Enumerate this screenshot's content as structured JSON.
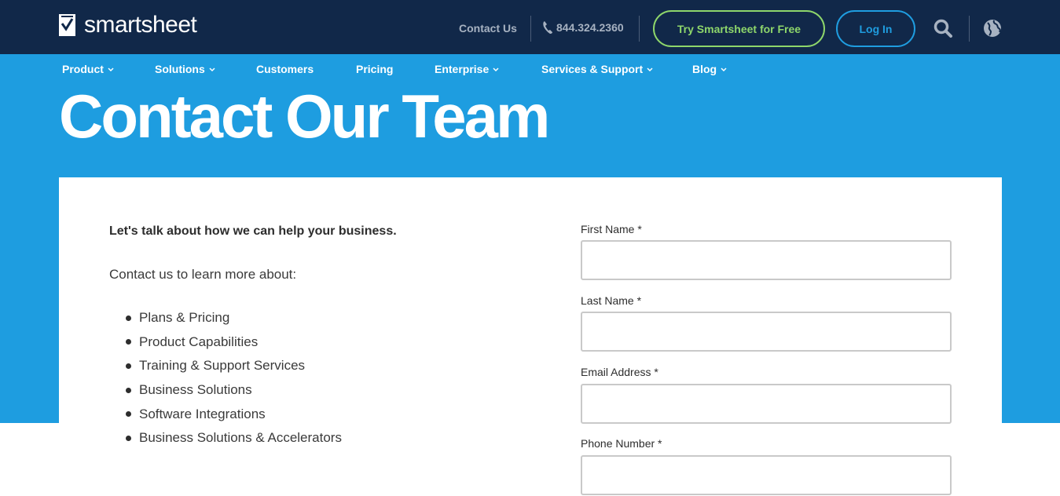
{
  "header": {
    "logo_text": "smartsheet",
    "contact_label": "Contact Us",
    "phone": "844.324.2360",
    "try_label": "Try Smartsheet for Free",
    "login_label": "Log In",
    "colors": {
      "bar": "#112849",
      "try": "#8ed66b",
      "login": "#1f9de0"
    }
  },
  "nav": {
    "items": [
      {
        "label": "Product",
        "dropdown": true
      },
      {
        "label": "Solutions",
        "dropdown": true
      },
      {
        "label": "Customers",
        "dropdown": false
      },
      {
        "label": "Pricing",
        "dropdown": false
      },
      {
        "label": "Enterprise",
        "dropdown": true
      },
      {
        "label": "Services & Support",
        "dropdown": true
      },
      {
        "label": "Blog",
        "dropdown": true
      }
    ]
  },
  "hero": {
    "title": "Contact Our Team",
    "color": "#1e9de0"
  },
  "intro": {
    "headline": "Let's talk about how we can help your business.",
    "subhead": "Contact us to learn more about:",
    "topics": [
      "Plans & Pricing",
      "Product Capabilities",
      "Training & Support Services",
      "Business Solutions",
      "Software Integrations",
      "Business Solutions & Accelerators"
    ]
  },
  "form": {
    "fields": [
      {
        "label": "First Name *",
        "value": ""
      },
      {
        "label": "Last Name *",
        "value": ""
      },
      {
        "label": "Email Address *",
        "value": ""
      },
      {
        "label": "Phone Number *",
        "value": ""
      }
    ]
  }
}
